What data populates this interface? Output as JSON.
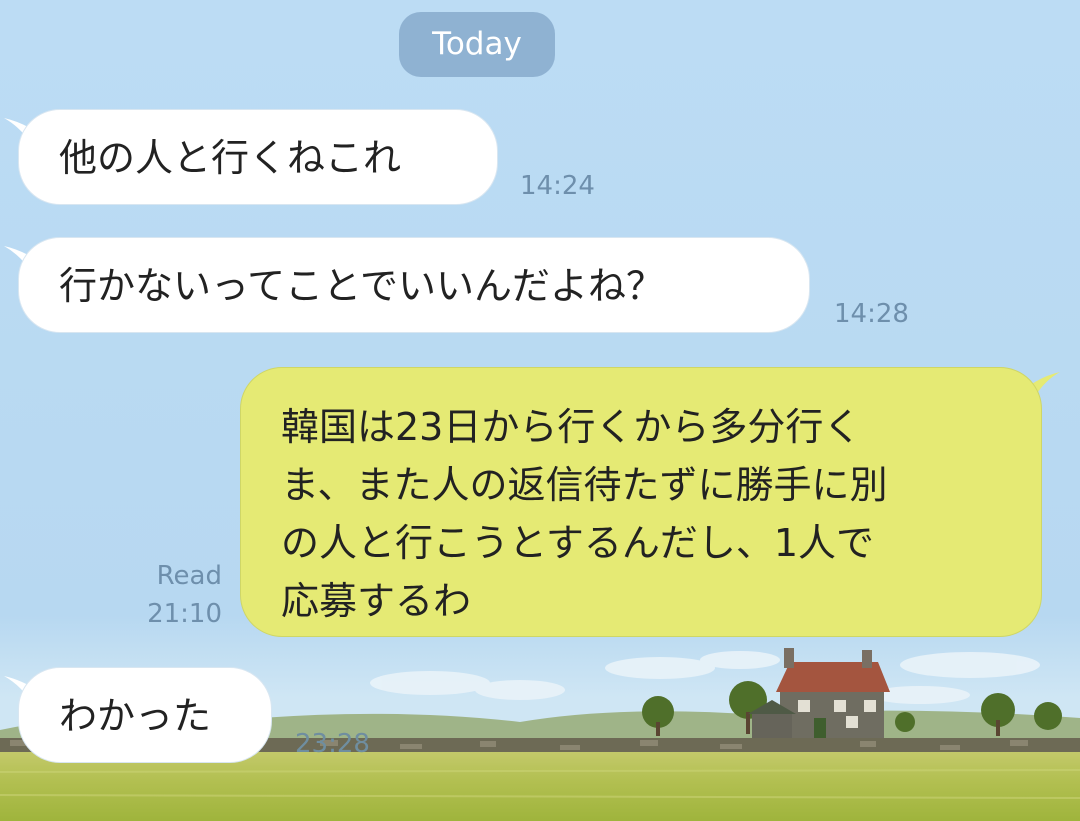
{
  "day_separator": {
    "label": "Today"
  },
  "messages": [
    {
      "direction": "incoming",
      "text": "他の人と行くねこれ",
      "time": "14:24"
    },
    {
      "direction": "incoming",
      "text": "行かないってことでいいんだよね？",
      "time": "14:28"
    },
    {
      "direction": "outgoing",
      "lines": [
        "韓国は23日から行くから多分行く",
        "ま、また人の返信待たずに勝手に別",
        "の人と行こうとするんだし、1人で",
        "応募するわ"
      ],
      "status": "Read",
      "time": "21:10"
    },
    {
      "direction": "incoming",
      "text": "わかった",
      "time": "23:28"
    }
  ],
  "colors": {
    "sky": "#bcdcf4",
    "incoming_bubble": "#ffffff",
    "outgoing_bubble": "#e5ea74",
    "timestamp": "#6e8fac",
    "day_chip": "#8fb2d2",
    "grass": "#a9bb45"
  },
  "background": {
    "description_icon": "countryside-house-wallpaper"
  }
}
